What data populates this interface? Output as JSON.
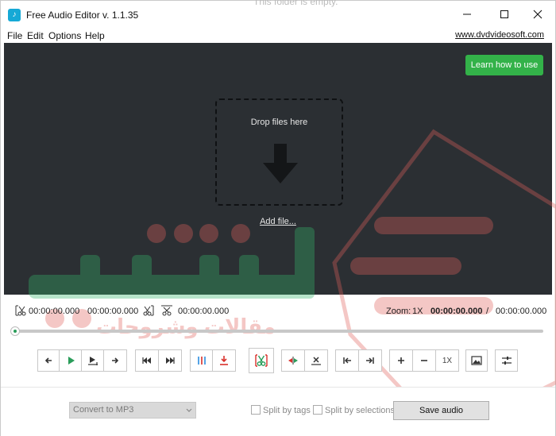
{
  "window": {
    "title": "Free Audio Editor v. 1.1.35",
    "background_text": "This folder is empty."
  },
  "menu": {
    "items": [
      "File",
      "Edit",
      "Options",
      "Help"
    ],
    "site_link": "www.dvdvideosoft.com"
  },
  "workspace": {
    "learn_button": "Learn how to use",
    "drop_text": "Drop files here",
    "add_file": "Add file..."
  },
  "timebar": {
    "start_time": "00:00:00.000",
    "end_time": "00:00:00.000",
    "cut_time": "00:00:00.000",
    "zoom_label": "Zoom:",
    "zoom_value": "1X",
    "current_time": "00:00:00.000",
    "separator": "/",
    "total_time": "00:00:00.000"
  },
  "toolbar": {
    "zoom_reset_label": "1X"
  },
  "bottom": {
    "format_select": "Convert to MP3",
    "split_by_tags": "Split by tags",
    "split_by_selections": "Split by selections",
    "save_button": "Save audio"
  },
  "watermark": {
    "arabic_text": "مقالات وشروحات"
  },
  "colors": {
    "accent_green": "#33b249",
    "dark_bg": "#2b2f33",
    "cut_red": "#d9302b",
    "play_green": "#2a9d5a"
  }
}
